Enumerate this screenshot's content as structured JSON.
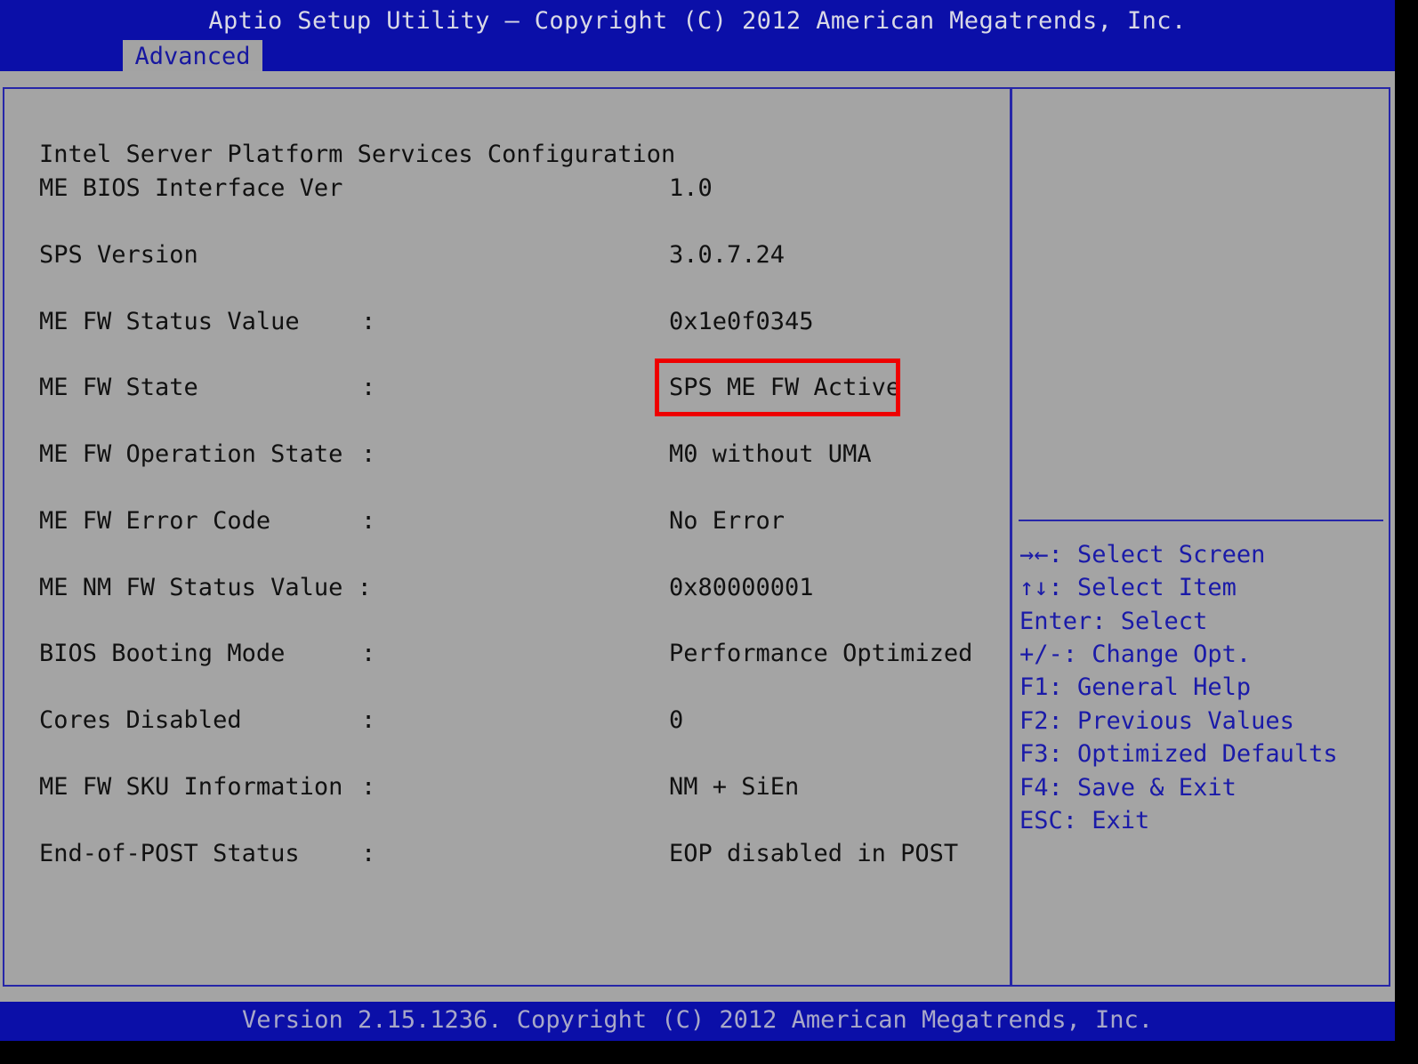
{
  "header": {
    "title": "Aptio Setup Utility – Copyright (C) 2012 American Megatrends, Inc.",
    "tab": "Advanced"
  },
  "main": {
    "section_title": "Intel Server Platform Services Configuration",
    "rows": [
      {
        "label": "ME BIOS Interface Ver",
        "colon": "",
        "value": "1.0"
      },
      {
        "label": "SPS Version",
        "colon": "",
        "value": "3.0.7.24"
      },
      {
        "label": "ME FW Status Value",
        "colon": ":",
        "value": "0x1e0f0345"
      },
      {
        "label": "ME FW State",
        "colon": ":",
        "value": "SPS ME FW Active"
      },
      {
        "label": "ME FW Operation State",
        "colon": ":",
        "value": "M0 without UMA"
      },
      {
        "label": "ME FW Error Code",
        "colon": ":",
        "value": "No Error"
      },
      {
        "label": "ME NM FW Status Value :",
        "colon": "",
        "value": "0x80000001"
      },
      {
        "label": "BIOS Booting Mode",
        "colon": ":",
        "value": "Performance Optimized"
      },
      {
        "label": "Cores Disabled",
        "colon": ":",
        "value": "0"
      },
      {
        "label": "ME FW SKU Information",
        "colon": ":",
        "value": "NM + SiEn"
      },
      {
        "label": "End-of-POST Status",
        "colon": ":",
        "value": "EOP disabled in POST"
      }
    ]
  },
  "help": [
    "→←: Select Screen",
    "↑↓: Select Item",
    "Enter: Select",
    "+/-: Change Opt.",
    "F1: General Help",
    "F2: Previous Values",
    "F3: Optimized Defaults",
    "F4: Save & Exit",
    "ESC: Exit"
  ],
  "footer": {
    "version": "Version 2.15.1236. Copyright (C) 2012 American Megatrends, Inc."
  },
  "colors": {
    "header_blue": "#0b0fa8",
    "panel_gray": "#a4a4a4",
    "help_text_blue": "#1a1aa8",
    "highlight_red": "#ee0000"
  }
}
